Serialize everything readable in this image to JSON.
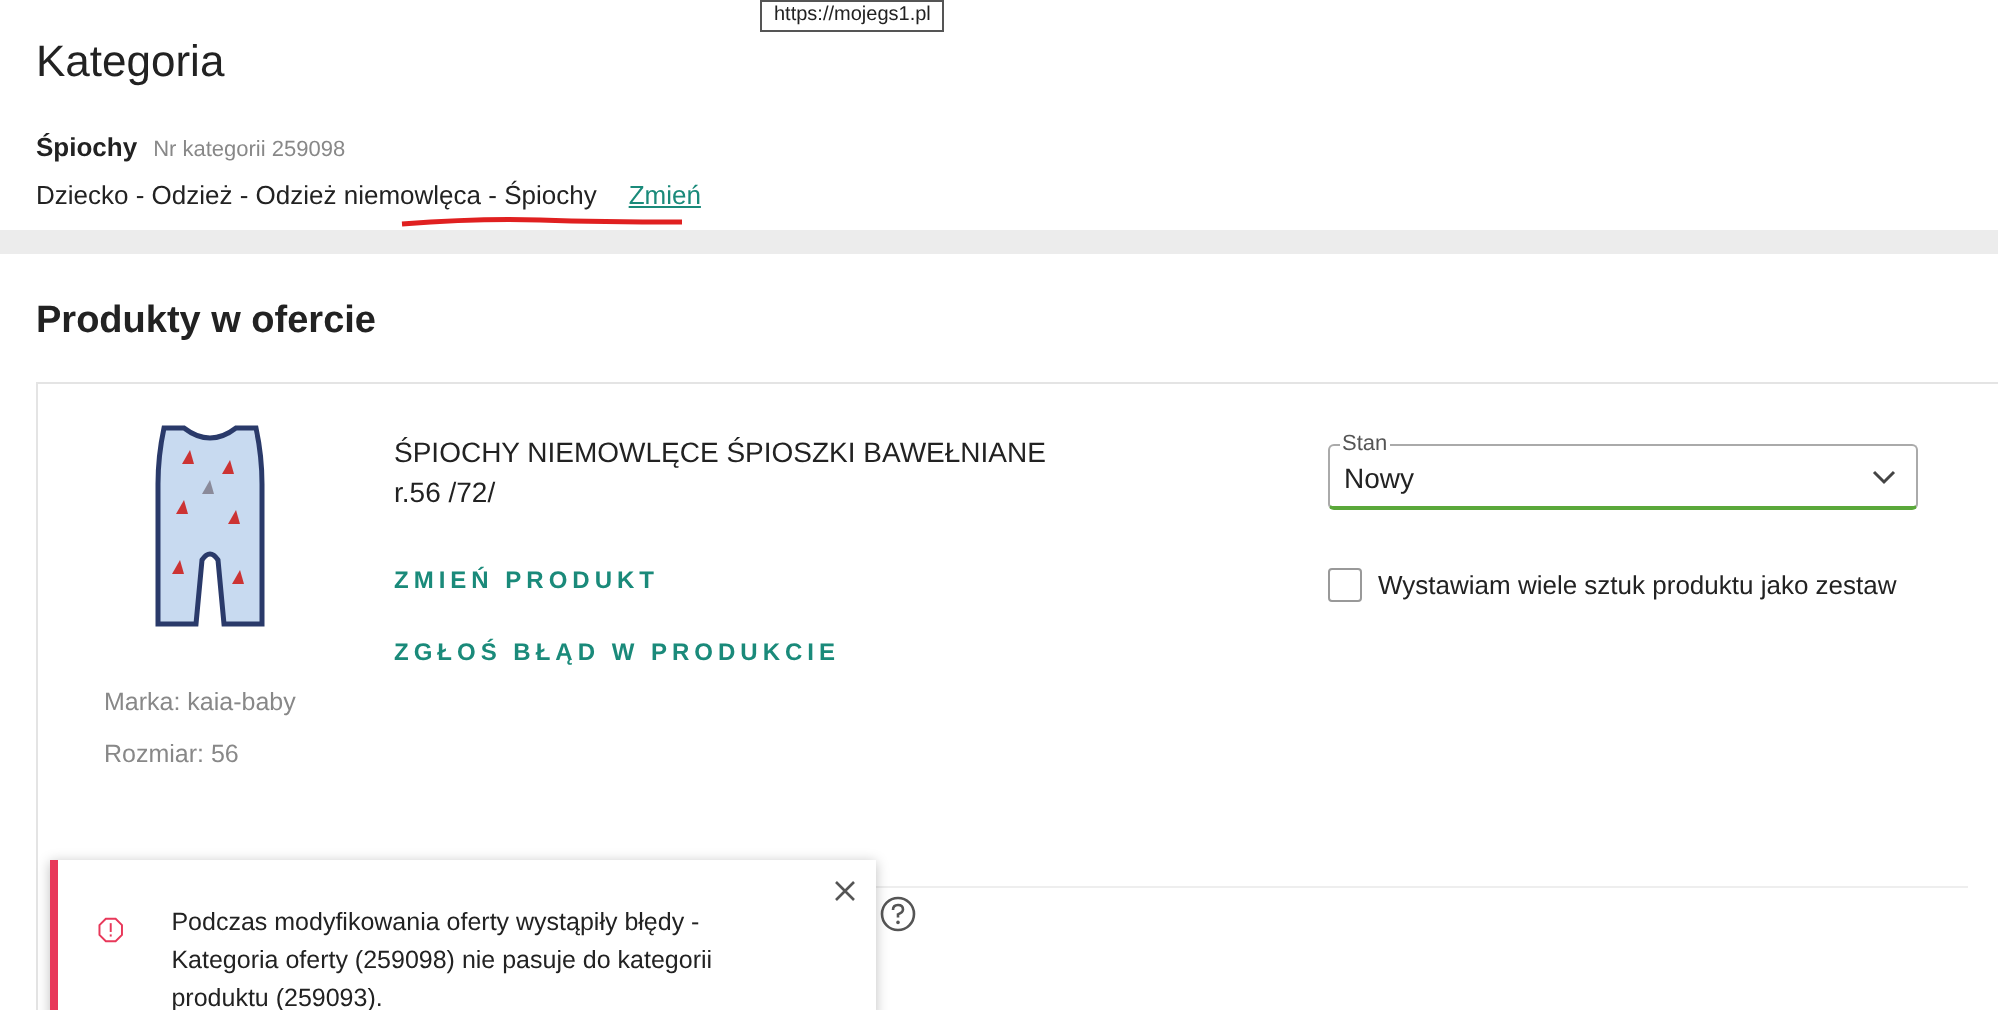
{
  "tooltip": {
    "text": "https://mojegs1.pl"
  },
  "category": {
    "heading": "Kategoria",
    "name": "Śpiochy",
    "number": "Nr kategorii 259098",
    "path": "Dziecko - Odzież - Odzież niemowlęca - Śpiochy",
    "change_link": "Zmień"
  },
  "products": {
    "heading": "Produkty w ofercie",
    "title": "ŚPIOCHY NIEMOWLĘCE ŚPIOSZKI BAWEŁNIANE r.56 /72/",
    "actions": [
      "ZMIEŃ PRODUKT",
      "ZGŁOŚ BŁĄD W PRODUKCIE"
    ],
    "details": [
      "Marka: kaia-baby",
      "Rozmiar: 56"
    ],
    "condition": {
      "label": "Stan",
      "value": "Nowy"
    },
    "set_checkbox": {
      "label": "Wystawiam wiele sztuk produktu jako zestaw",
      "checked": false
    }
  },
  "toast": {
    "kind": "error",
    "message": "Podczas modyfikowania oferty wystąpiły błędy - Kategoria oferty (259098) nie pasuje do kategorii produktu (259093)."
  }
}
